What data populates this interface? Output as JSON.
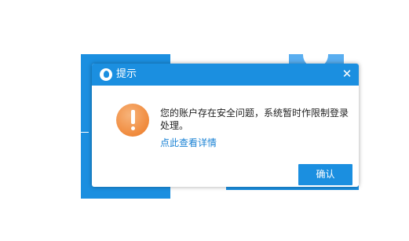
{
  "dialog": {
    "title": "提示",
    "message": "您的账户存在安全问题，系统暂时作限制登录处理。",
    "detail_link": "点此查看详情",
    "confirm_label": "确认",
    "close_glyph": "✕"
  },
  "icons": {
    "app": "app-logo-icon",
    "close": "close-icon",
    "warning": "warning-exclamation-icon"
  },
  "colors": {
    "accent": "#1b8fe0",
    "link": "#1a82d4",
    "warning": "#f08a3c"
  }
}
